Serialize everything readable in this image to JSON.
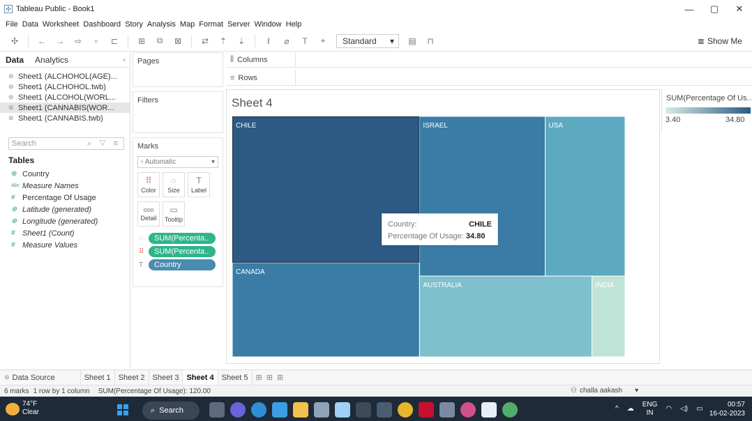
{
  "window": {
    "title": "Tableau Public - Book1",
    "controls": [
      "—",
      "▢",
      "✕"
    ]
  },
  "menu": [
    "File",
    "Data",
    "Worksheet",
    "Dashboard",
    "Story",
    "Analysis",
    "Map",
    "Format",
    "Server",
    "Window",
    "Help"
  ],
  "toolbar": {
    "fit": "Standard",
    "show_me": "Show Me"
  },
  "data_panel": {
    "tabs": [
      "Data",
      "Analytics"
    ],
    "sources": [
      "Sheet1 (ALCHOHOL(AGE)...",
      "Sheet1 (ALCHOHOL.twb)",
      "Sheet1 (ALCOHOL(WORL...",
      "Sheet1 (CANNABIS(WOR...",
      "Sheet1 (CANNABIS.twb)"
    ],
    "search_placeholder": "Search",
    "tables_heading": "Tables",
    "fields": [
      {
        "icon": "⊕",
        "label": "Country",
        "italic": false
      },
      {
        "icon": "Abc",
        "label": "Measure Names",
        "italic": true
      },
      {
        "icon": "#",
        "label": "Percentage Of Usage",
        "italic": false
      },
      {
        "icon": "⊕",
        "label": "Latitude (generated)",
        "italic": true
      },
      {
        "icon": "⊕",
        "label": "Longitude (generated)",
        "italic": true
      },
      {
        "icon": "#",
        "label": "Sheet1 (Count)",
        "italic": true
      },
      {
        "icon": "#",
        "label": "Measure Values",
        "italic": true
      }
    ]
  },
  "cards": {
    "pages": "Pages",
    "filters": "Filters",
    "marks": "Marks",
    "mark_type": "Automatic",
    "mark_buttons": [
      {
        "glyph": "⠿",
        "label": "Color"
      },
      {
        "glyph": "◌",
        "label": "Size"
      },
      {
        "glyph": "T",
        "label": "Label"
      },
      {
        "glyph": "ooo",
        "label": "Detail"
      },
      {
        "glyph": "▭",
        "label": "Tooltip"
      }
    ],
    "pills": [
      {
        "icon": "◌",
        "label": "SUM(Percenta..",
        "kind": "green"
      },
      {
        "icon": "⠿",
        "label": "SUM(Percenta..",
        "kind": "green"
      },
      {
        "icon": "T",
        "label": "Country",
        "kind": "blue"
      }
    ]
  },
  "shelves": {
    "columns": "Columns",
    "rows": "Rows"
  },
  "sheet": {
    "title": "Sheet 4"
  },
  "legend": {
    "title": "SUM(Percentage Of Us...",
    "min": "3.40",
    "max": "34.80",
    "color_low": "#d8ece6",
    "color_high": "#2b5a85"
  },
  "chart_data": {
    "type": "treemap",
    "measure": "SUM(Percentage Of Usage)",
    "total": 120.0,
    "items": [
      {
        "label": "CHILE",
        "value": 34.8,
        "color": "#2c5a84"
      },
      {
        "label": "CANADA",
        "value": 22.4,
        "color": "#3a7ca5"
      },
      {
        "label": "ISRAEL",
        "value": 25.5,
        "color": "#3a7ca5"
      },
      {
        "label": "USA",
        "value": 16.2,
        "color": "#5ca9c0"
      },
      {
        "label": "AUSTRALIA",
        "value": 17.7,
        "color": "#7ec0cc"
      },
      {
        "label": "INDIA",
        "value": 3.4,
        "color": "#bfe3d7"
      }
    ]
  },
  "tooltip": {
    "country_key": "Country:",
    "country_value": "CHILE",
    "usage_key": "Percentage Of Usage:",
    "usage_value": "34.80"
  },
  "sheet_tabs": {
    "data_source": "Data Source",
    "tabs": [
      "Sheet 1",
      "Sheet 2",
      "Sheet 3",
      "Sheet 4",
      "Sheet 5"
    ],
    "active": "Sheet 4"
  },
  "status": {
    "marks": "6 marks",
    "dims": "1 row by 1 column",
    "sum": "SUM(Percentage Of Usage): 120.00",
    "user": "challa aakash"
  },
  "taskbar": {
    "temp": "74°F",
    "weather": "Clear",
    "search": "Search",
    "lang1": "ENG",
    "lang2": "IN",
    "time": "00:57",
    "date": "16-02-2023"
  }
}
